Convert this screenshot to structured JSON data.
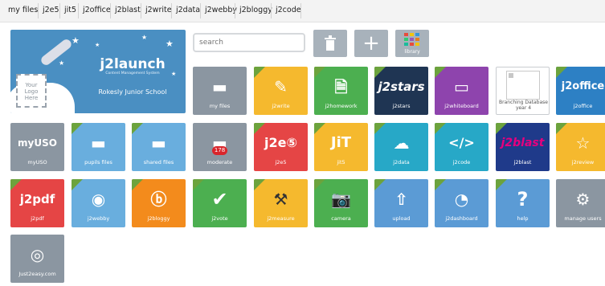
{
  "nav": [
    "my files",
    "j2e5",
    "jit5",
    "j2office",
    "j2blast",
    "j2write",
    "j2data",
    "j2webby",
    "j2bloggy",
    "j2code"
  ],
  "banner": {
    "brand": "j2launch",
    "subtitle": "Content Management System",
    "school": "Rokesly Junior School",
    "logo_placeholder": "Your Logo Here"
  },
  "search": {
    "placeholder": "search"
  },
  "toolbar": {
    "library_label": "library"
  },
  "tiles": [
    {
      "label": "my files",
      "color": "#8b96a1",
      "icon": "folder-icon"
    },
    {
      "label": "j2write",
      "color": "#f5b92e",
      "icon": "pencil-icon"
    },
    {
      "label": "j2homework",
      "color": "#4caf50",
      "icon": "homework-icon"
    },
    {
      "label": "j2stars",
      "color": "#1f3553",
      "icon": "stars-icon"
    },
    {
      "label": "j2whiteboard",
      "color": "#8e44ad",
      "icon": "whiteboard-icon"
    },
    {
      "label": "Branching Database year 4",
      "color": "#ffffff",
      "icon": "broken-image-icon"
    },
    {
      "label": "j2office",
      "color": "#2d80c4",
      "icon": "office-icon"
    },
    {
      "label": "myUSO",
      "color": "#8b96a1",
      "icon": "myuso-icon"
    },
    {
      "label": "pupils files",
      "color": "#69aede",
      "icon": "pupils-files-icon"
    },
    {
      "label": "shared files",
      "color": "#69aede",
      "icon": "shared-files-icon"
    },
    {
      "label": "moderate",
      "color": "#8b96a1",
      "icon": "moderate-icon"
    },
    {
      "label": "j2e5",
      "color": "#e54545",
      "icon": "j2e5-icon"
    },
    {
      "label": "jit5",
      "color": "#f5b92e",
      "icon": "jit-icon"
    },
    {
      "label": "j2data",
      "color": "#27a8c7",
      "icon": "cloud-data-icon"
    },
    {
      "label": "j2code",
      "color": "#27a8c7",
      "icon": "code-icon"
    },
    {
      "label": "j2blast",
      "color": "#1f3a8a",
      "icon": "blast-icon"
    },
    {
      "label": "j2review",
      "color": "#f5b92e",
      "icon": "review-star-icon"
    },
    {
      "label": "j2pdf",
      "color": "#e54545",
      "icon": "pdf-icon"
    },
    {
      "label": "j2webby",
      "color": "#69aede",
      "icon": "globe-icon"
    },
    {
      "label": "j2bloggy",
      "color": "#f38b1c",
      "icon": "bloggy-icon"
    },
    {
      "label": "j2vote",
      "color": "#4caf50",
      "icon": "tick-icon"
    },
    {
      "label": "j2measure",
      "color": "#f5b92e",
      "icon": "compass-icon"
    },
    {
      "label": "camera",
      "color": "#4caf50",
      "icon": "camera-icon"
    },
    {
      "label": "upload",
      "color": "#5b9bd5",
      "icon": "upload-icon"
    },
    {
      "label": "j2dashboard",
      "color": "#5b9bd5",
      "icon": "gauge-icon"
    },
    {
      "label": "help",
      "color": "#5b9bd5",
      "icon": "question-icon"
    },
    {
      "label": "manage users",
      "color": "#8b96a1",
      "icon": "tools-icon"
    },
    {
      "label": "Just2easy.com",
      "color": "#8b96a1",
      "icon": "globe-icon"
    }
  ],
  "moderate_count": "178"
}
